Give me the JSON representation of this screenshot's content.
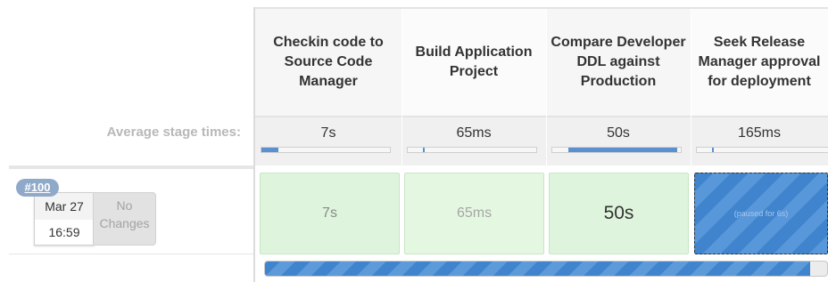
{
  "left": {
    "average_label": "Average stage times:",
    "build_number": "#100",
    "date": "Mar 27",
    "time": "16:59",
    "changes": "No Changes"
  },
  "stages": [
    {
      "name": "Checkin code to Source Code Manager",
      "avg": "7s",
      "avg_fraction": 0.13,
      "run_time": "7s",
      "state": "success"
    },
    {
      "name": "Build Application Project",
      "avg": "65ms",
      "avg_fraction": 0.1,
      "run_time": "65ms",
      "state": "success"
    },
    {
      "name": "Compare Developer DDL against Production",
      "avg": "50s",
      "avg_fraction": 0.85,
      "run_time": "50s",
      "state": "success"
    },
    {
      "name": "Seek Release Manager approval for deployment",
      "avg": "165ms",
      "avg_fraction": 0.1,
      "run_time": "(paused for 6s)",
      "state": "paused"
    }
  ],
  "run_progress": 0.97,
  "colors": {
    "success": "#dff4dc",
    "paused": "#3f84cc",
    "progress": "#5b8fd0"
  }
}
